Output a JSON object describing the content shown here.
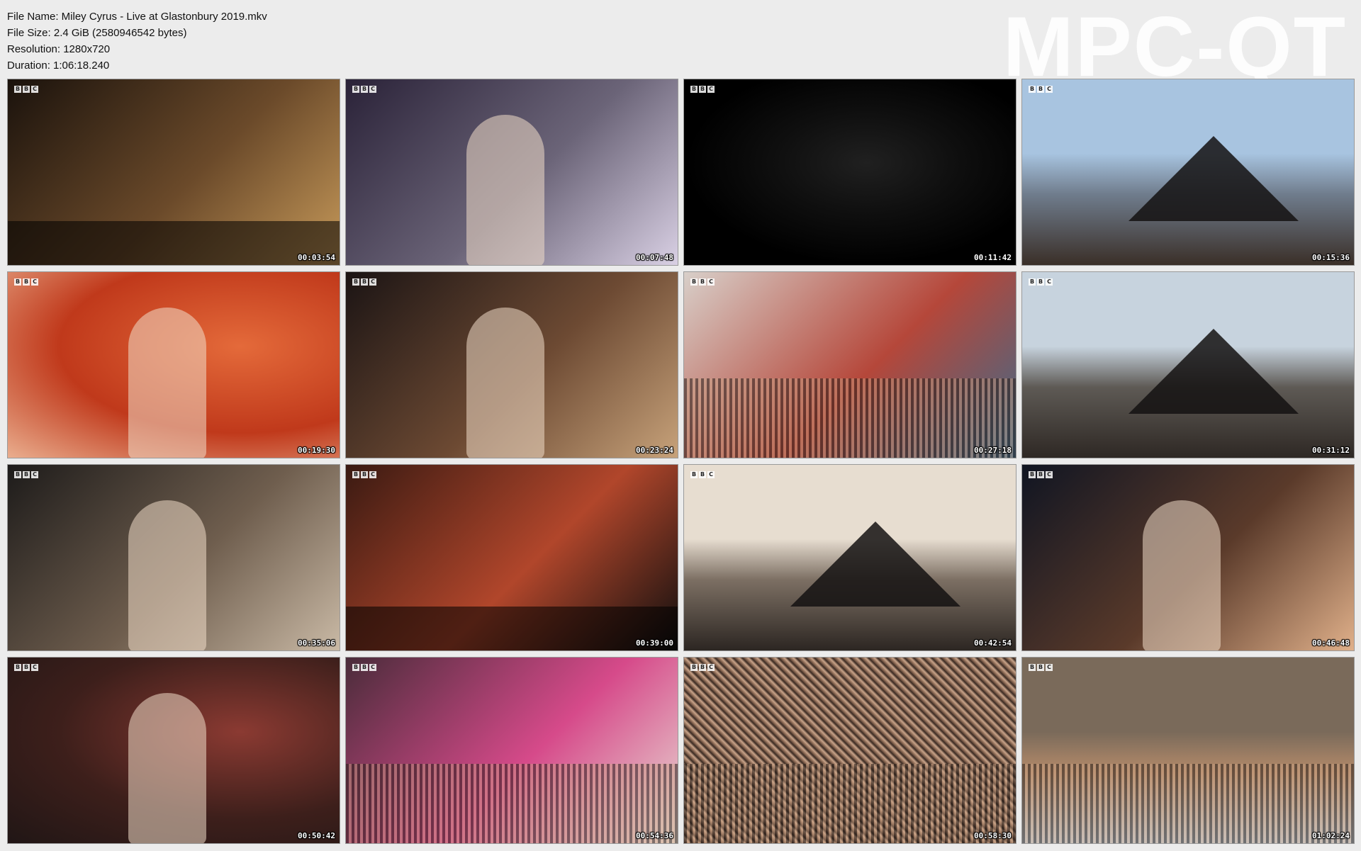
{
  "info": {
    "file_name": "File Name: Miley Cyrus - Live at Glastonbury 2019.mkv",
    "file_size": "File Size: 2.4 GiB (2580946542 bytes)",
    "resolution": "Resolution: 1280x720",
    "duration": "Duration: 1:06:18.240"
  },
  "watermark": "MPC-QT",
  "thumbnails": [
    {
      "timestamp": "00:03:54",
      "scene": "stage-wide",
      "colors": [
        "#1a120c",
        "#6b4a2a",
        "#c79a5a"
      ]
    },
    {
      "timestamp": "00:07:48",
      "scene": "singer-smoke",
      "colors": [
        "#2a2238",
        "#6b6478",
        "#d9d0e4"
      ]
    },
    {
      "timestamp": "00:11:42",
      "scene": "dark-stage",
      "colors": [
        "#000000",
        "#0f0f0f",
        "#202020"
      ]
    },
    {
      "timestamp": "00:15:36",
      "scene": "pyramid-stage-day",
      "colors": [
        "#a8c4e0",
        "#6f7c8c",
        "#3a2f28"
      ]
    },
    {
      "timestamp": "00:19:30",
      "scene": "singer-closeup-red",
      "colors": [
        "#c0391b",
        "#e46a3a",
        "#f3c8a8"
      ]
    },
    {
      "timestamp": "00:23:24",
      "scene": "singer-amps",
      "colors": [
        "#1b1414",
        "#6d4a33",
        "#c7a27a"
      ]
    },
    {
      "timestamp": "00:27:18",
      "scene": "crowd-closeup",
      "colors": [
        "#d8cfc9",
        "#b5473a",
        "#3a6b8c"
      ]
    },
    {
      "timestamp": "00:31:12",
      "scene": "pyramid-crowd",
      "colors": [
        "#c7d3de",
        "#5e5a55",
        "#2e2824"
      ]
    },
    {
      "timestamp": "00:35:06",
      "scene": "singer-drums",
      "colors": [
        "#1d1b1a",
        "#6f5e4e",
        "#c9b9a5"
      ]
    },
    {
      "timestamp": "00:39:00",
      "scene": "stage-band",
      "colors": [
        "#3a1a12",
        "#b1462b",
        "#0e0e0e"
      ]
    },
    {
      "timestamp": "00:42:54",
      "scene": "pyramid-sunset",
      "colors": [
        "#e7ddd0",
        "#7c6f63",
        "#2c2622"
      ]
    },
    {
      "timestamp": "00:46:48",
      "scene": "singer-stage-night",
      "colors": [
        "#101522",
        "#5a3a2a",
        "#e0b08a"
      ]
    },
    {
      "timestamp": "00:50:42",
      "scene": "guest-cowboy",
      "colors": [
        "#3d1f1b",
        "#8b3a32",
        "#1a1414"
      ]
    },
    {
      "timestamp": "00:54:36",
      "scene": "crowd-flags",
      "colors": [
        "#4a2c3a",
        "#d64a8a",
        "#e9e0d6"
      ]
    },
    {
      "timestamp": "00:58:30",
      "scene": "crowd-wide",
      "colors": [
        "#3a2a22",
        "#8c6a55",
        "#c9a48a"
      ]
    },
    {
      "timestamp": "01:02:24",
      "scene": "crowd-flags-wide",
      "colors": [
        "#7a6a5a",
        "#b58b6a",
        "#c9d6e0"
      ]
    }
  ]
}
